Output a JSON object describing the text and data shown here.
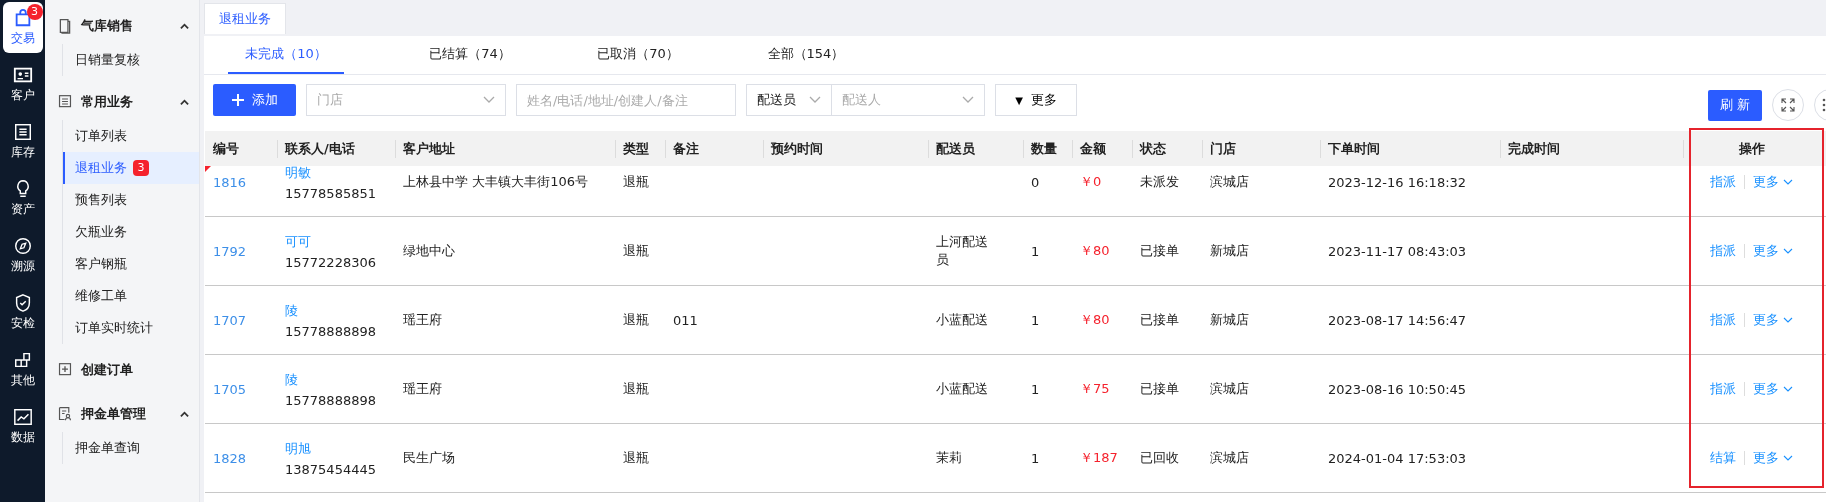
{
  "rail": [
    {
      "label": "交易",
      "selected": true,
      "badge": "3"
    },
    {
      "label": "客户",
      "selected": false
    },
    {
      "label": "库存",
      "selected": false
    },
    {
      "label": "资产",
      "selected": false
    },
    {
      "label": "溯源",
      "selected": false
    },
    {
      "label": "安检",
      "selected": false
    },
    {
      "label": "其他",
      "selected": false
    },
    {
      "label": "数据",
      "selected": false
    }
  ],
  "sidebar": [
    {
      "label": "气库销售",
      "expanded": true,
      "children": [
        {
          "label": "日销量复核",
          "selected": false
        }
      ]
    },
    {
      "label": "常用业务",
      "expanded": true,
      "children": [
        {
          "label": "订单列表",
          "selected": false
        },
        {
          "label": "退租业务",
          "selected": true,
          "badge": "3"
        },
        {
          "label": "预售列表",
          "selected": false
        },
        {
          "label": "欠瓶业务",
          "selected": false
        },
        {
          "label": "客户钢瓶",
          "selected": false
        },
        {
          "label": "维修工单",
          "selected": false
        },
        {
          "label": "订单实时统计",
          "selected": false
        }
      ]
    },
    {
      "label": "创建订单"
    },
    {
      "label": "押金单管理",
      "expanded": true,
      "children": [
        {
          "label": "押金单查询",
          "selected": false
        }
      ]
    }
  ],
  "page_tab": "退租业务",
  "status_tabs": [
    {
      "label": "未完成（10）",
      "selected": true
    },
    {
      "label": "已结算（74）",
      "selected": false
    },
    {
      "label": "已取消（70）",
      "selected": false
    },
    {
      "label": "全部（154）",
      "selected": false
    }
  ],
  "toolbar": {
    "add_button": "添加",
    "store": {
      "placeholder": "门店"
    },
    "search": {
      "placeholder": "姓名/电话/地址/创建人/备注"
    },
    "courier_type": {
      "value": "配送员"
    },
    "courier": {
      "placeholder": "配送人"
    },
    "more_button": {
      "icon": "▼",
      "label": "更多"
    },
    "refresh_button": "刷 新"
  },
  "table": {
    "columns": [
      {
        "label": "编号"
      },
      {
        "label": "联系人/电话"
      },
      {
        "label": "客户地址"
      },
      {
        "label": "类型"
      },
      {
        "label": "备注"
      },
      {
        "label": "预约时间"
      },
      {
        "label": "配送员"
      },
      {
        "label": "数量"
      },
      {
        "label": "金额"
      },
      {
        "label": "状态"
      },
      {
        "label": "门店"
      },
      {
        "label": "下单时间"
      },
      {
        "label": "完成时间"
      },
      {
        "label": "操作",
        "highlighted": true
      }
    ],
    "rows": [
      {
        "id": "1816",
        "name": "明敏",
        "phone": "15778585851",
        "address": "上林县中学 大丰镇大丰街106号",
        "type": "退瓶",
        "quantity": "0",
        "amount": "￥0",
        "status": "未派发",
        "store": "滨城店",
        "order_time": "2023-12-16 16:18:32",
        "action": "指派",
        "more": "更多",
        "flagged": true
      },
      {
        "id": "1792",
        "name": "可可",
        "phone": "15772228306",
        "address": "绿地中心",
        "type": "退瓶",
        "courier": "上河配送员",
        "quantity": "1",
        "amount": "￥80",
        "status": "已接单",
        "store": "新城店",
        "order_time": "2023-11-17 08:43:03",
        "action": "指派",
        "more": "更多"
      },
      {
        "id": "1707",
        "name": "陵",
        "phone": "15778888898",
        "address": "瑶王府",
        "type": "退瓶",
        "note": "011",
        "courier": "小蓝配送",
        "quantity": "1",
        "amount": "￥80",
        "status": "已接单",
        "store": "新城店",
        "order_time": "2023-08-17 14:56:47",
        "action": "指派",
        "more": "更多"
      },
      {
        "id": "1705",
        "name": "陵",
        "phone": "15778888898",
        "address": "瑶王府",
        "type": "退瓶",
        "courier": "小蓝配送",
        "quantity": "1",
        "amount": "￥75",
        "status": "已接单",
        "store": "滨城店",
        "order_time": "2023-08-16 10:50:45",
        "action": "指派",
        "more": "更多"
      },
      {
        "id": "1828",
        "name": "明旭",
        "phone": "13875454445",
        "address": "民生广场",
        "type": "退瓶",
        "courier": "茉莉",
        "quantity": "1",
        "amount": "￥187",
        "status": "已回收",
        "store": "滨城店",
        "order_time": "2024-01-04 17:53:03",
        "action": "结算",
        "more": "更多"
      }
    ]
  }
}
